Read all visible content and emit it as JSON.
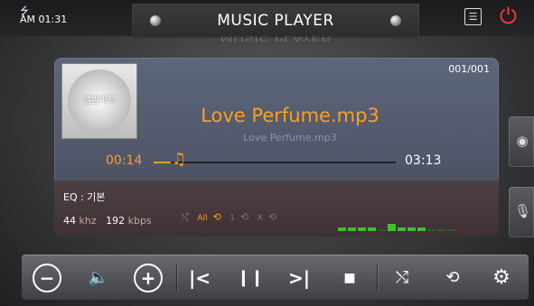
{
  "status": {
    "time": "AM 01:31",
    "usb_icon": "usb-plug-icon"
  },
  "header": {
    "title": "MUSIC PLAYER"
  },
  "album": {
    "art_label": "앨범아트"
  },
  "track": {
    "counter": "001/001",
    "title": "Love Perfume.mp3",
    "subtitle": "Love Perfume.mp3",
    "elapsed": "00:14",
    "total": "03:13",
    "progress": 0.072
  },
  "audio": {
    "eq": "EQ : 기본",
    "sample_rate": "44",
    "sample_rate_unit": "khz",
    "bitrate": "192",
    "bitrate_unit": "kbps"
  },
  "modes": {
    "shuffle": "shuffle-icon",
    "repeat_all": "All",
    "repeat_one": "1",
    "repeat_off": "X"
  },
  "eq_levels": [
    1,
    1,
    1,
    1,
    0,
    2,
    1,
    1,
    1,
    0,
    0,
    0
  ],
  "colors": {
    "accent": "#ff9f1c",
    "power": "#ff3b2f",
    "eq_bar": "#3fbf2f"
  },
  "controls": [
    "minus-icon",
    "speaker-icon",
    "plus-icon",
    "skip-back-icon",
    "pause-icon",
    "skip-forward-icon",
    "stop-icon",
    "shuffle-icon",
    "repeat-icon",
    "gear-icon"
  ]
}
